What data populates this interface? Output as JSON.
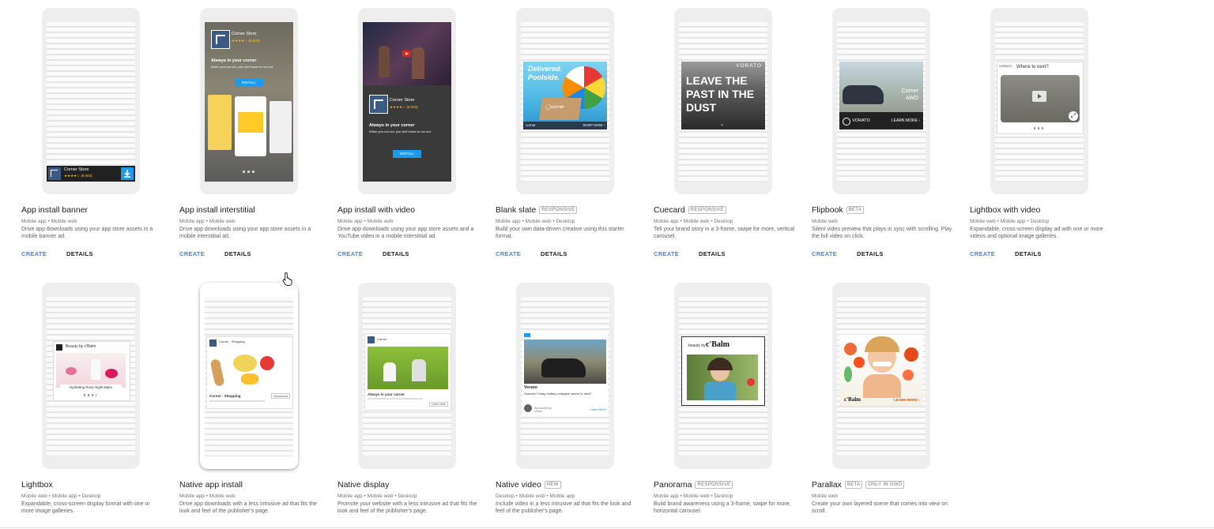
{
  "cards": [
    {
      "name": "App install banner",
      "badges": [],
      "platforms": "Mobile app • Mobile web",
      "description": "Drive app downloads using your app store assets in a mobile banner ad.",
      "creative": {
        "app_name": "Corner Store",
        "rating": "★★★★☆ (9,093)"
      }
    },
    {
      "name": "App install interstitial",
      "badges": [],
      "platforms": "Mobile app • Mobile web",
      "description": "Drive app downloads using your app store assets in a mobile interstitial ad.",
      "creative": {
        "app_name": "Corner Store",
        "rating": "★★★★☆ (9,093)",
        "headline": "Always in your corner",
        "subline": "When you run out, you don't have to run out.",
        "button": "INSTALL"
      }
    },
    {
      "name": "App install with video",
      "badges": [],
      "platforms": "Mobile app • Mobile web",
      "description": "Drive app downloads using your app store assets and a YouTube video in a mobile interstitial ad.",
      "creative": {
        "app_name": "Corner Store",
        "rating": "★★★★☆ (9,093)",
        "headline": "Always in your corner",
        "subline": "When you run out, you don't have to run out.",
        "button": "INSTALL"
      }
    },
    {
      "name": "Blank slate",
      "badges": [
        "RESPONSIVE"
      ],
      "platforms": "Mobile app • Mobile web • Desktop",
      "description": "Build your own data-driven creative using this starter format.",
      "creative": {
        "headline_1": "Delivered.",
        "headline_2": "Poolside.",
        "brand": "corner",
        "cta": "SHOP NOW ›"
      }
    },
    {
      "name": "Cuecard",
      "badges": [
        "RESPONSIVE"
      ],
      "platforms": "Mobile app • Mobile web • Desktop",
      "description": "Tell your brand story in a 3-frame, swipe for more, vertical carousel.",
      "creative": {
        "brand": "VORATO",
        "line_1": "LEAVE THE",
        "line_2": "PAST IN THE",
        "line_3": "DUST"
      }
    },
    {
      "name": "Flipbook",
      "badges": [
        "BETA"
      ],
      "platforms": "Mobile web",
      "description": "Silent video preview that plays in sync with scrolling. Play the full video on click.",
      "creative": {
        "model_1": "Corner",
        "model_2": "AWD",
        "brand": "VORATO",
        "cta": "LEARN MORE ›"
      }
    },
    {
      "name": "Lightbox with video",
      "badges": [],
      "platforms": "Mobile web • Mobile app • Desktop",
      "description": "Expandable, cross-screen display ad with one or more videos and optional image galleries.",
      "creative": {
        "brand": "VORATO",
        "title": "Where to next?"
      }
    },
    {
      "name": "Lightbox",
      "badges": [],
      "platforms": "Mobile web • Mobile app • Desktop",
      "description": "Expandable, cross-screen display format with one or more image galleries.",
      "creative": {
        "brand": "Beauty by c'Balm",
        "caption": "Hydrating Rose Night Balm"
      }
    },
    {
      "name": "Native app install",
      "badges": [],
      "platforms": "Mobile app • Mobile web",
      "description": "Drive app downloads with a less intrusive ad that fits the look and feel of the publisher's page.",
      "creative": {
        "app_name": "Corner - Shopping",
        "footer_title": "Corner - Shopping",
        "footer_button": "Download"
      }
    },
    {
      "name": "Native display",
      "badges": [],
      "platforms": "Mobile app • Mobile web • Desktop",
      "description": "Promote your website with a less intrusive ad that fits the look and feel of the publisher's page.",
      "creative": {
        "brand": "Corner",
        "headline": "Always in your corner",
        "button": "Learn more"
      }
    },
    {
      "name": "Native video",
      "badges": [
        "NEW"
      ],
      "platforms": "Desktop • Mobile web • Mobile app",
      "description": "Include video in a less intrusive ad that fits the look and feel of the publisher's page.",
      "creative": {
        "title": "Vorato",
        "text": "Summer Friday, battery charged: where to next?",
        "sponsor": "Sponsored by Vorato",
        "link": "Learn More"
      }
    },
    {
      "name": "Panorama",
      "badges": [
        "RESPONSIVE"
      ],
      "platforms": "Mobile app • Mobile web • Desktop",
      "description": "Build brand awareness using a 3-frame, swipe for more, horizontal carousel.",
      "creative": {
        "brand_prefix": "beauty by",
        "brand": "c'Balm"
      }
    },
    {
      "name": "Parallax",
      "badges": [
        "BETA",
        "ONLY IN GWD"
      ],
      "platforms": "Mobile web",
      "description": "Create your own layered scene that comes into view on scroll.",
      "creative": {
        "brand": "c'Balm",
        "cta": "LEARN MORE ›"
      }
    }
  ],
  "actions": {
    "create": "CREATE",
    "details": "DETAILS"
  },
  "colors": {
    "link_blue": "#4285f4",
    "phone_bg": "#eeeeee",
    "install_blue": "#1e9be8"
  }
}
